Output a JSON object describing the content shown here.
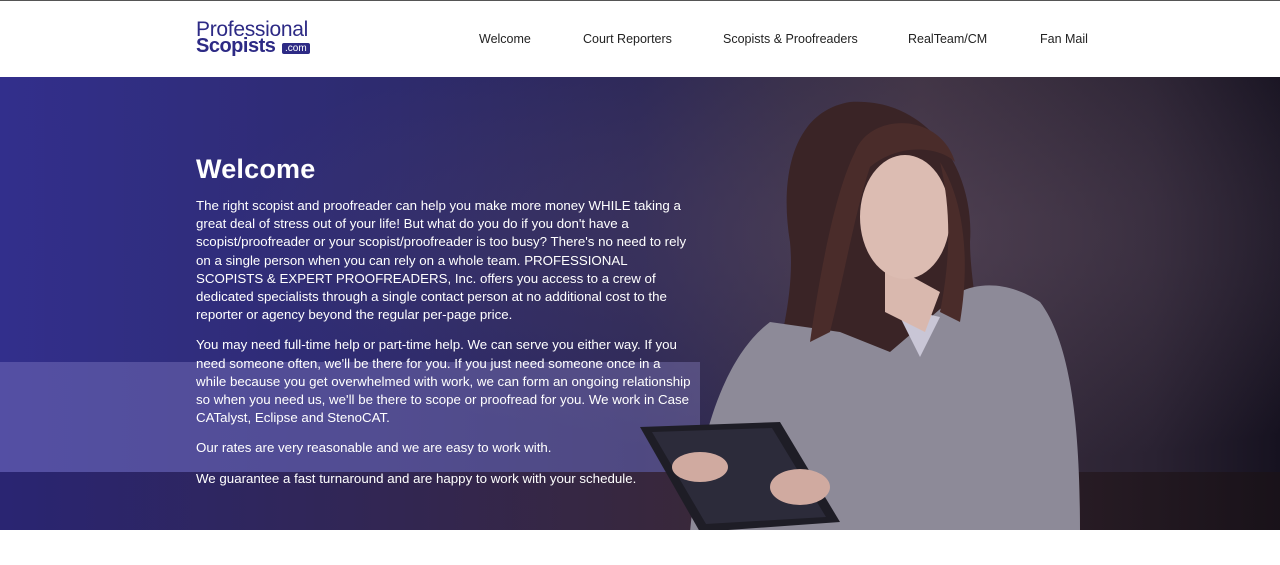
{
  "logo": {
    "line1": "Professional",
    "line2": "Scopists",
    "com": ".com"
  },
  "nav": {
    "items": [
      {
        "label": "Welcome"
      },
      {
        "label": "Court Reporters"
      },
      {
        "label": "Scopists & Proofreaders"
      },
      {
        "label": "RealTeam/CM"
      },
      {
        "label": "Fan Mail"
      }
    ]
  },
  "hero": {
    "title": "Welcome",
    "paragraphs": [
      "The right scopist and proofreader can help you make more money WHILE taking a great deal of stress out of your life! But what do you do if you don't have a scopist/proofreader or your scopist/proofreader is too busy? There's no need to rely on a single person when you can rely on a whole team. PROFESSIONAL SCOPISTS & EXPERT PROOFREADERS, Inc. offers you access to a crew of dedicated specialists through a single contact person at no additional cost to the reporter or agency beyond the regular per-page price.",
      "You may need full-time help or part-time help. We can serve you either way. If you need someone often, we'll be there for you. If you just need someone once in a while because you get overwhelmed with work, we can form an ongoing relationship so when you need us, we'll be there to scope or proofread for you. We work in Case CATalyst, Eclipse and StenoCAT.",
      "Our rates are very reasonable and we are easy to work with.",
      "We guarantee a fast turnaround and are happy to work with your schedule."
    ]
  },
  "colors": {
    "brand": "#2d2a85",
    "hero_overlay": "#322f8c"
  }
}
